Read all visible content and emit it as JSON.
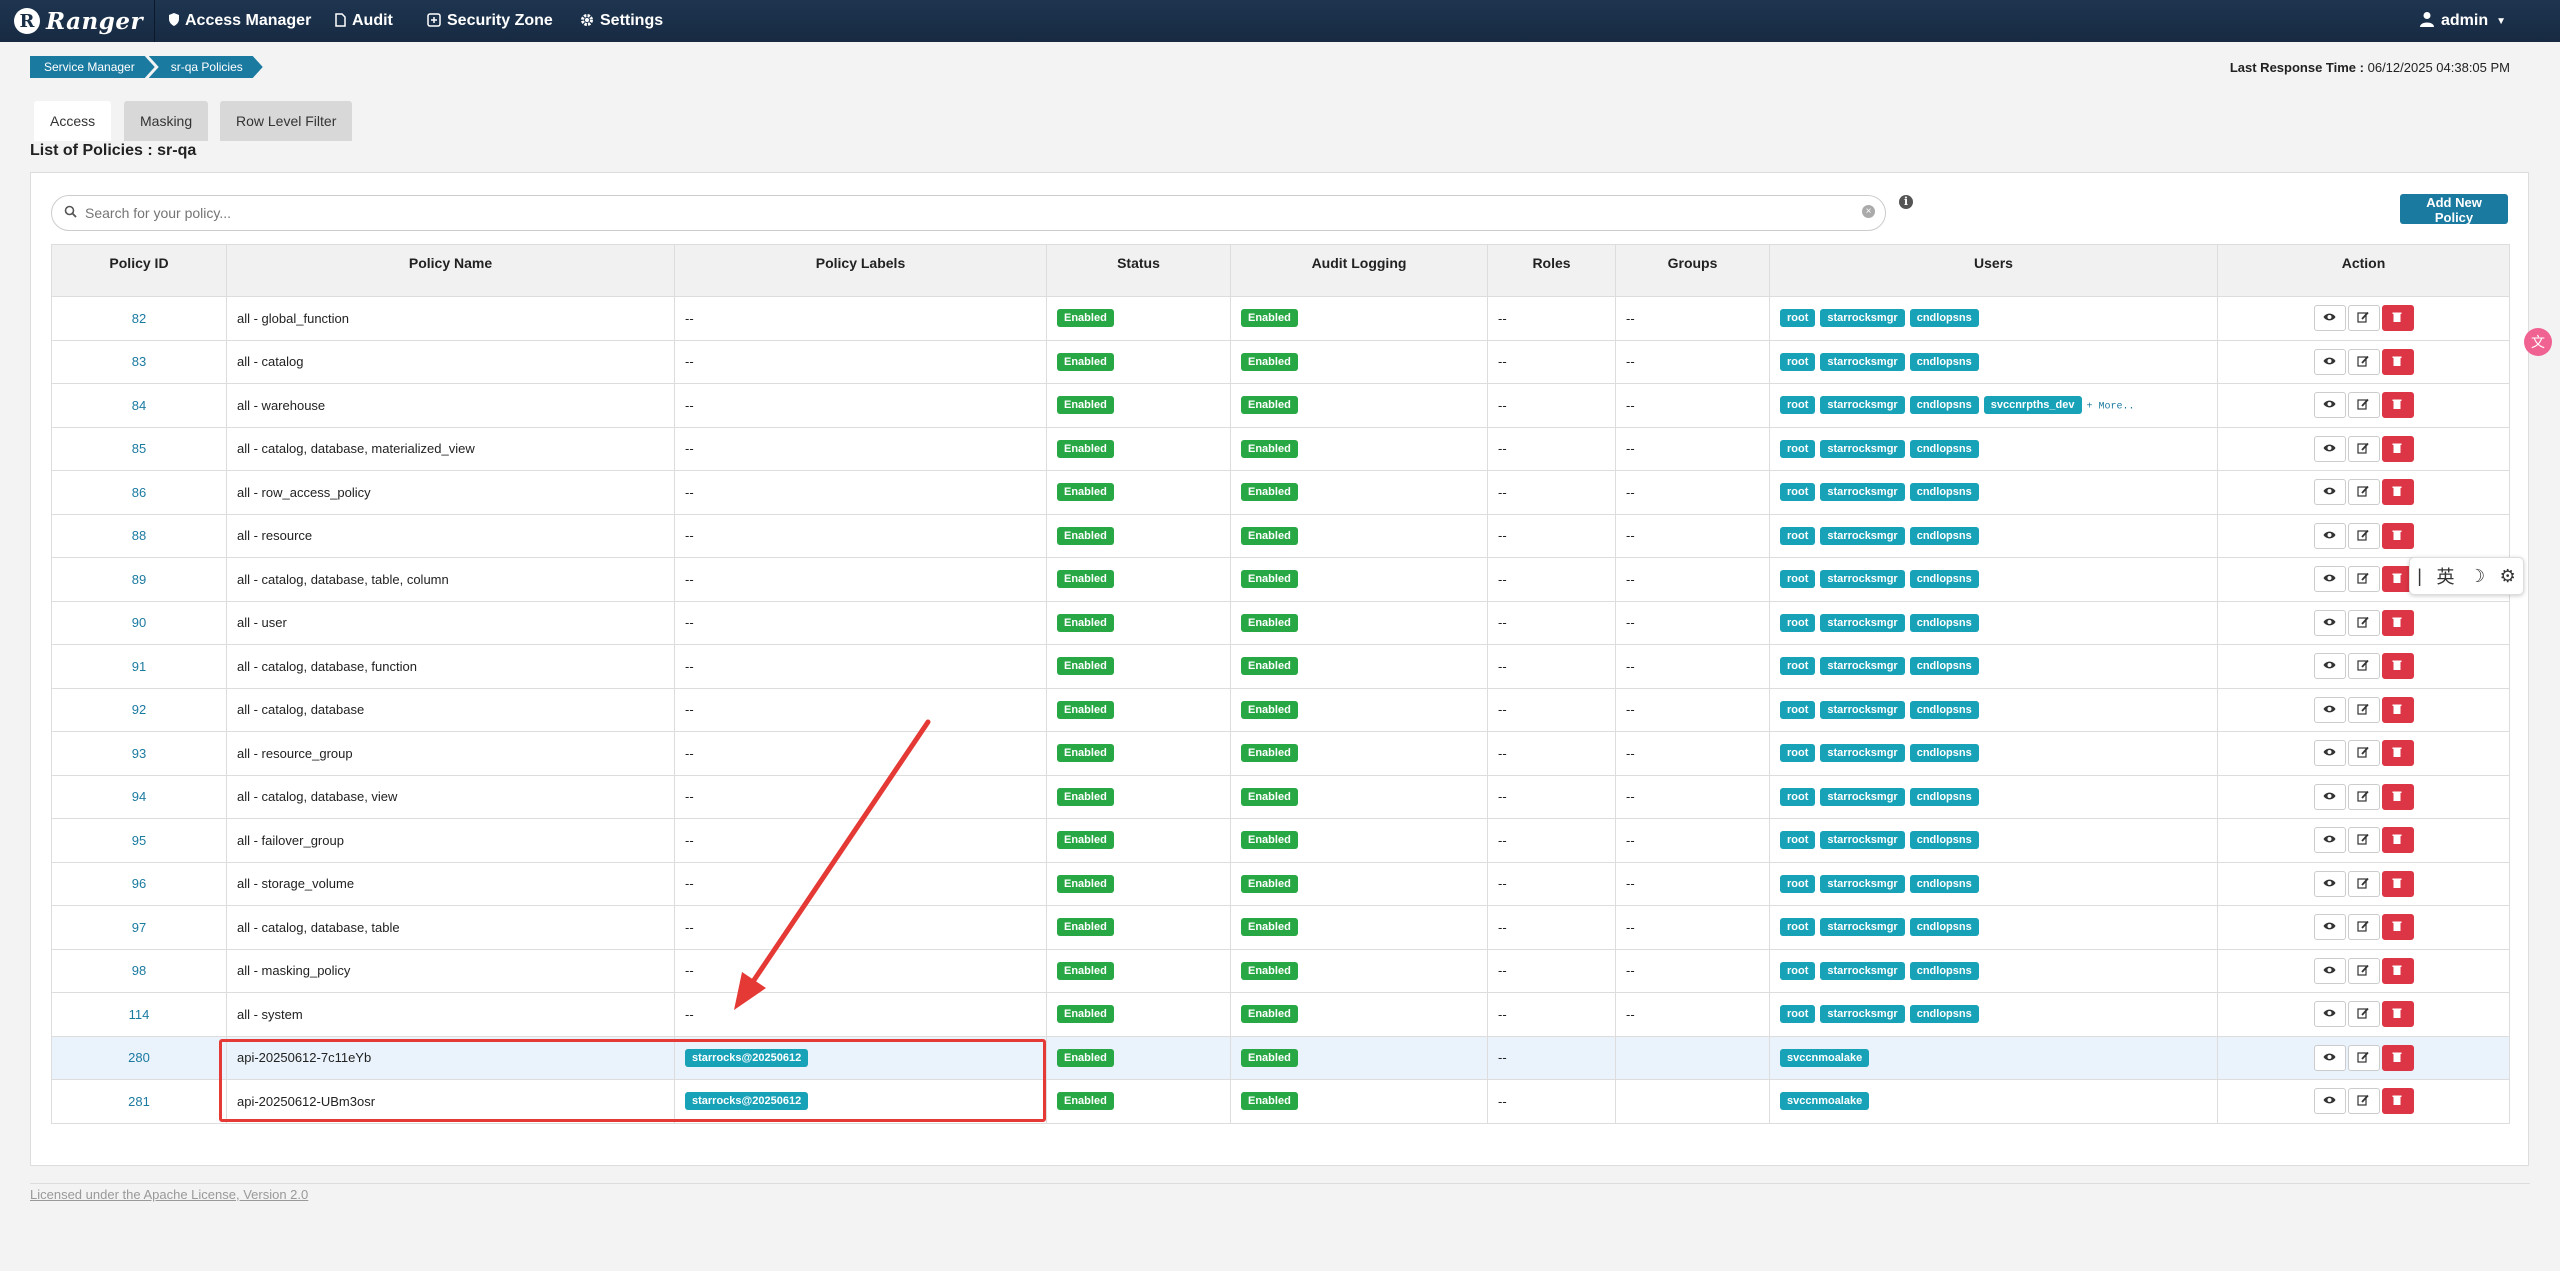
{
  "nav": {
    "brand": "Ranger",
    "brand_logo": "R",
    "items": [
      {
        "label": "Access Manager",
        "icon": "shield-icon"
      },
      {
        "label": "Audit",
        "icon": "file-icon"
      },
      {
        "label": "Security Zone",
        "icon": "zone-icon"
      },
      {
        "label": "Settings",
        "icon": "gear-icon"
      }
    ],
    "user": "admin"
  },
  "breadcrumb": [
    "Service Manager",
    "sr-qa Policies"
  ],
  "last_response": {
    "label": "Last Response Time :",
    "value": "06/12/2025 04:38:05 PM"
  },
  "tabs": [
    "Access",
    "Masking",
    "Row Level Filter"
  ],
  "list_title": "List of Policies : sr-qa",
  "search": {
    "placeholder": "Search for your policy..."
  },
  "add_button": "Add New Policy",
  "table": {
    "headers": [
      "Policy ID",
      "Policy Name",
      "Policy Labels",
      "Status",
      "Audit Logging",
      "Roles",
      "Groups",
      "Users",
      "Action"
    ],
    "rows": [
      {
        "id": "82",
        "name": "all - global_function",
        "labels": [
          "--"
        ],
        "status": "Enabled",
        "audit": "Enabled",
        "roles": "--",
        "groups": "--",
        "users": [
          "root",
          "starrocksmgr",
          "cndlopsns"
        ],
        "more": ""
      },
      {
        "id": "83",
        "name": "all - catalog",
        "labels": [
          "--"
        ],
        "status": "Enabled",
        "audit": "Enabled",
        "roles": "--",
        "groups": "--",
        "users": [
          "root",
          "starrocksmgr",
          "cndlopsns"
        ],
        "more": ""
      },
      {
        "id": "84",
        "name": "all - warehouse",
        "labels": [
          "--"
        ],
        "status": "Enabled",
        "audit": "Enabled",
        "roles": "--",
        "groups": "--",
        "users": [
          "root",
          "starrocksmgr",
          "cndlopsns",
          "svccnrpths_dev"
        ],
        "more": "+ More.."
      },
      {
        "id": "85",
        "name": "all - catalog, database, materialized_view",
        "labels": [
          "--"
        ],
        "status": "Enabled",
        "audit": "Enabled",
        "roles": "--",
        "groups": "--",
        "users": [
          "root",
          "starrocksmgr",
          "cndlopsns"
        ],
        "more": ""
      },
      {
        "id": "86",
        "name": "all - row_access_policy",
        "labels": [
          "--"
        ],
        "status": "Enabled",
        "audit": "Enabled",
        "roles": "--",
        "groups": "--",
        "users": [
          "root",
          "starrocksmgr",
          "cndlopsns"
        ],
        "more": ""
      },
      {
        "id": "88",
        "name": "all - resource",
        "labels": [
          "--"
        ],
        "status": "Enabled",
        "audit": "Enabled",
        "roles": "--",
        "groups": "--",
        "users": [
          "root",
          "starrocksmgr",
          "cndlopsns"
        ],
        "more": ""
      },
      {
        "id": "89",
        "name": "all - catalog, database, table, column",
        "labels": [
          "--"
        ],
        "status": "Enabled",
        "audit": "Enabled",
        "roles": "--",
        "groups": "--",
        "users": [
          "root",
          "starrocksmgr",
          "cndlopsns"
        ],
        "more": ""
      },
      {
        "id": "90",
        "name": "all - user",
        "labels": [
          "--"
        ],
        "status": "Enabled",
        "audit": "Enabled",
        "roles": "--",
        "groups": "--",
        "users": [
          "root",
          "starrocksmgr",
          "cndlopsns"
        ],
        "more": ""
      },
      {
        "id": "91",
        "name": "all - catalog, database, function",
        "labels": [
          "--"
        ],
        "status": "Enabled",
        "audit": "Enabled",
        "roles": "--",
        "groups": "--",
        "users": [
          "root",
          "starrocksmgr",
          "cndlopsns"
        ],
        "more": ""
      },
      {
        "id": "92",
        "name": "all - catalog, database",
        "labels": [
          "--"
        ],
        "status": "Enabled",
        "audit": "Enabled",
        "roles": "--",
        "groups": "--",
        "users": [
          "root",
          "starrocksmgr",
          "cndlopsns"
        ],
        "more": ""
      },
      {
        "id": "93",
        "name": "all - resource_group",
        "labels": [
          "--"
        ],
        "status": "Enabled",
        "audit": "Enabled",
        "roles": "--",
        "groups": "--",
        "users": [
          "root",
          "starrocksmgr",
          "cndlopsns"
        ],
        "more": ""
      },
      {
        "id": "94",
        "name": "all - catalog, database, view",
        "labels": [
          "--"
        ],
        "status": "Enabled",
        "audit": "Enabled",
        "roles": "--",
        "groups": "--",
        "users": [
          "root",
          "starrocksmgr",
          "cndlopsns"
        ],
        "more": ""
      },
      {
        "id": "95",
        "name": "all - failover_group",
        "labels": [
          "--"
        ],
        "status": "Enabled",
        "audit": "Enabled",
        "roles": "--",
        "groups": "--",
        "users": [
          "root",
          "starrocksmgr",
          "cndlopsns"
        ],
        "more": ""
      },
      {
        "id": "96",
        "name": "all - storage_volume",
        "labels": [
          "--"
        ],
        "status": "Enabled",
        "audit": "Enabled",
        "roles": "--",
        "groups": "--",
        "users": [
          "root",
          "starrocksmgr",
          "cndlopsns"
        ],
        "more": ""
      },
      {
        "id": "97",
        "name": "all - catalog, database, table",
        "labels": [
          "--"
        ],
        "status": "Enabled",
        "audit": "Enabled",
        "roles": "--",
        "groups": "--",
        "users": [
          "root",
          "starrocksmgr",
          "cndlopsns"
        ],
        "more": ""
      },
      {
        "id": "98",
        "name": "all - masking_policy",
        "labels": [
          "--"
        ],
        "status": "Enabled",
        "audit": "Enabled",
        "roles": "--",
        "groups": "--",
        "users": [
          "root",
          "starrocksmgr",
          "cndlopsns"
        ],
        "more": ""
      },
      {
        "id": "114",
        "name": "all - system",
        "labels": [
          "--"
        ],
        "status": "Enabled",
        "audit": "Enabled",
        "roles": "--",
        "groups": "--",
        "users": [
          "root",
          "starrocksmgr",
          "cndlopsns"
        ],
        "more": ""
      },
      {
        "id": "280",
        "name": "api-20250612-7c11eYb",
        "labels": [
          "starrocks@20250612"
        ],
        "status": "Enabled",
        "audit": "Enabled",
        "roles": "--",
        "groups": "",
        "users": [
          "svccnmoalake"
        ],
        "more": "",
        "highlight": true
      },
      {
        "id": "281",
        "name": "api-20250612-UBm3osr",
        "labels": [
          "starrocks@20250612"
        ],
        "status": "Enabled",
        "audit": "Enabled",
        "roles": "--",
        "groups": "",
        "users": [
          "svccnmoalake"
        ],
        "more": ""
      }
    ]
  },
  "ime": {
    "cursor": "|",
    "lang": "英",
    "moon": "☽",
    "gear": "⚙"
  },
  "side_icon": "文",
  "footer": {
    "license": "Licensed under the Apache License, Version 2.0"
  },
  "colors": {
    "nav_bg": "#1e3550",
    "accent": "#1b7aa0",
    "enabled": "#28a745",
    "user_badge": "#17a2b8",
    "delete": "#dc3545",
    "annotation": "#e53935"
  }
}
